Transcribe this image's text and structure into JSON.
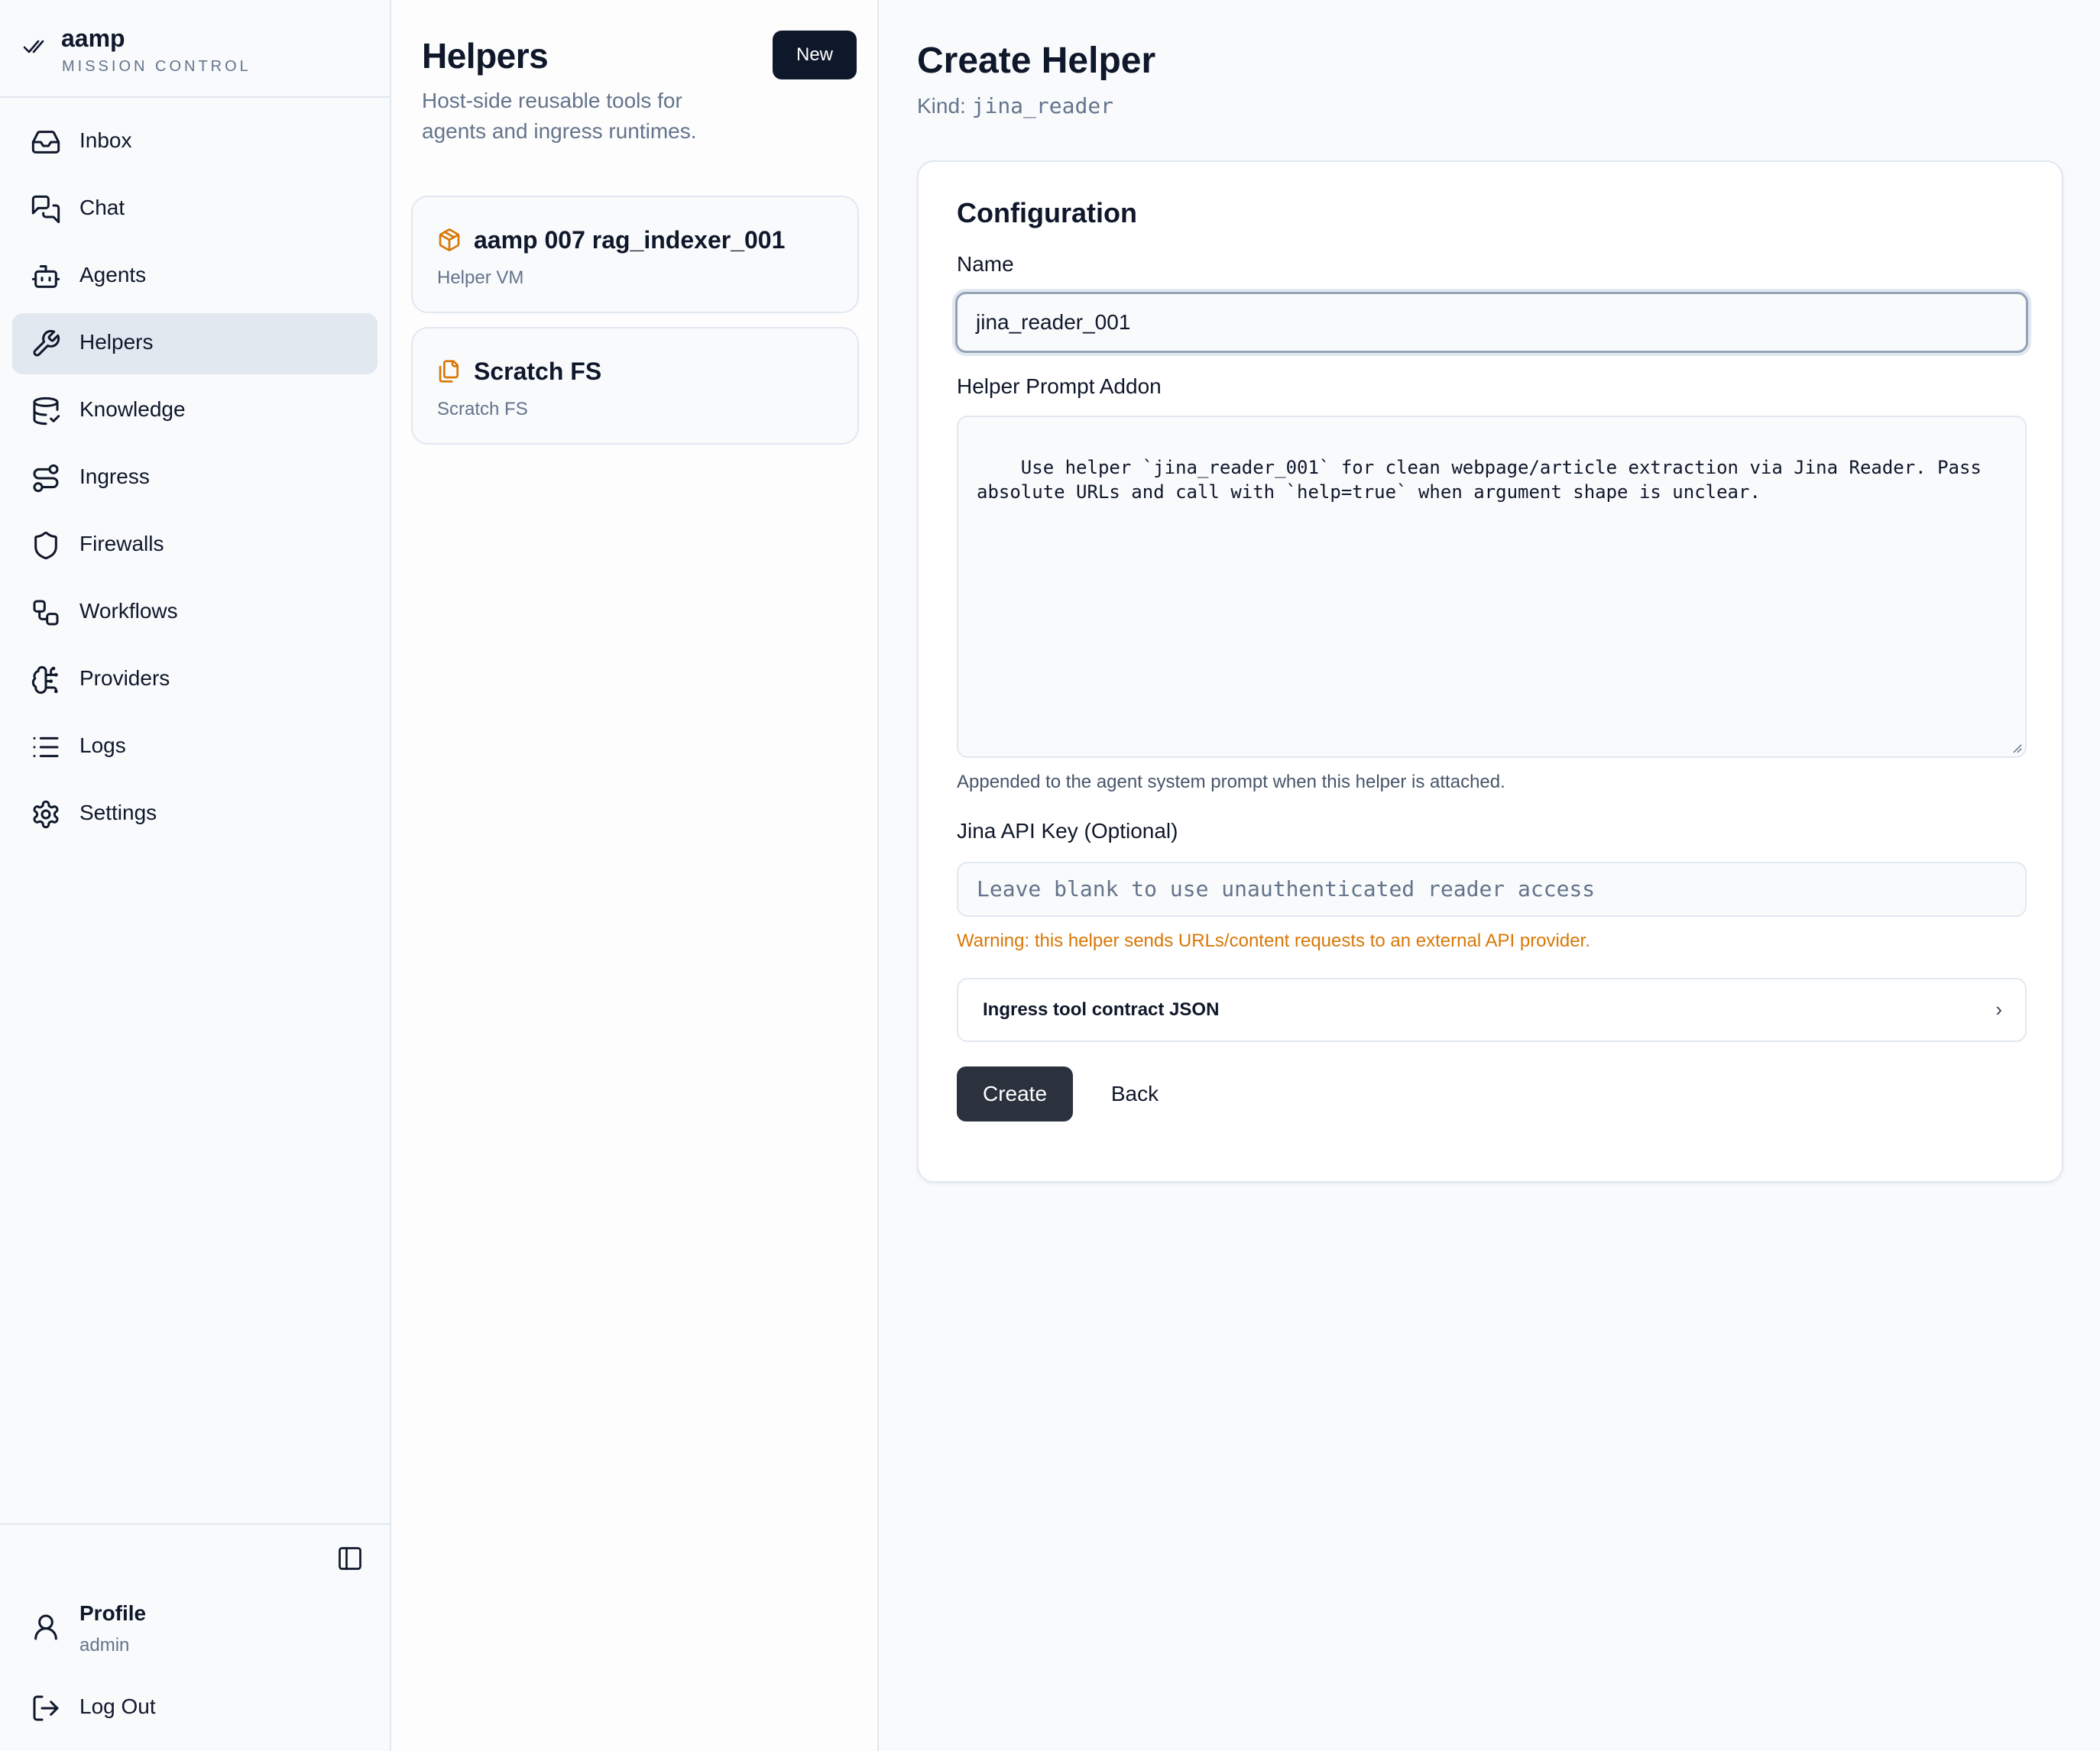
{
  "brand": {
    "name": "aamp",
    "subtitle": "MISSION CONTROL"
  },
  "sidebar": {
    "items": [
      {
        "label": "Inbox",
        "icon": "inbox-icon"
      },
      {
        "label": "Chat",
        "icon": "chat-icon"
      },
      {
        "label": "Agents",
        "icon": "bot-icon"
      },
      {
        "label": "Helpers",
        "icon": "wrench-icon",
        "active": true
      },
      {
        "label": "Knowledge",
        "icon": "database-icon"
      },
      {
        "label": "Ingress",
        "icon": "route-icon"
      },
      {
        "label": "Firewalls",
        "icon": "shield-icon"
      },
      {
        "label": "Workflows",
        "icon": "workflow-icon"
      },
      {
        "label": "Providers",
        "icon": "brain-icon"
      },
      {
        "label": "Logs",
        "icon": "list-icon"
      },
      {
        "label": "Settings",
        "icon": "gear-icon"
      }
    ],
    "profile": {
      "name": "Profile",
      "role": "admin"
    },
    "logout_label": "Log Out"
  },
  "helpers_panel": {
    "title": "Helpers",
    "description": "Host-side reusable tools for agents and ingress runtimes.",
    "new_label": "New",
    "cards": [
      {
        "title": "aamp 007 rag_indexer_001",
        "subtitle": "Helper VM",
        "icon": "package-icon"
      },
      {
        "title": "Scratch FS",
        "subtitle": "Scratch FS",
        "icon": "files-icon"
      }
    ]
  },
  "main": {
    "title": "Create Helper",
    "kind_label": "Kind:",
    "kind_value": "jina_reader",
    "config": {
      "title": "Configuration",
      "name_label": "Name",
      "name_value": "jina_reader_001",
      "prompt_label": "Helper Prompt Addon",
      "prompt_value": "Use helper `jina_reader_001` for clean webpage/article extraction via Jina Reader. Pass absolute URLs and call with `help=true` when argument shape is unclear.",
      "prompt_help": "Appended to the agent system prompt when this helper is attached.",
      "api_key_label": "Jina API Key (Optional)",
      "api_key_placeholder": "Leave blank to use unauthenticated reader access",
      "warning": "Warning: this helper sends URLs/content requests to an external API provider.",
      "contract_label": "Ingress tool contract JSON",
      "contract_chevron": "›",
      "create_label": "Create",
      "back_label": "Back"
    }
  },
  "colors": {
    "accent_dark": "#0f172a",
    "create_button": "#2b323d",
    "warning": "#d97706",
    "icon_orange": "#d97706",
    "active_nav_bg": "#e2e8f0"
  }
}
